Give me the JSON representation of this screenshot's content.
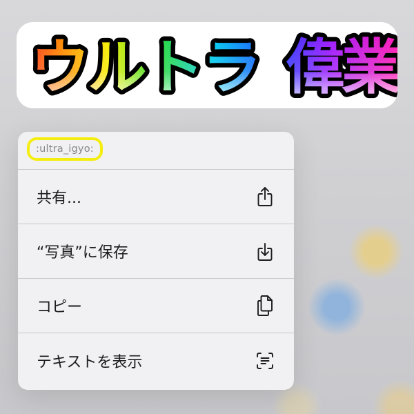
{
  "sticker": {
    "text": "ウルトラ偉業",
    "chars": [
      "ウ",
      "ル",
      "ト",
      "ラ",
      "偉",
      "業"
    ]
  },
  "menu": {
    "shortcode": ":ultra_igyo:",
    "items": [
      {
        "label": "共有...",
        "icon": "share-icon"
      },
      {
        "label": "“写真”に保存",
        "icon": "save-download-icon"
      },
      {
        "label": "コピー",
        "icon": "copy-icon"
      },
      {
        "label": "テキストを表示",
        "icon": "live-text-icon"
      }
    ]
  },
  "colors": {
    "menu_background": "#f2f2f5",
    "highlight_ring": "#f4ee10",
    "text_primary": "#1c1c1e",
    "text_secondary": "#86868b"
  }
}
